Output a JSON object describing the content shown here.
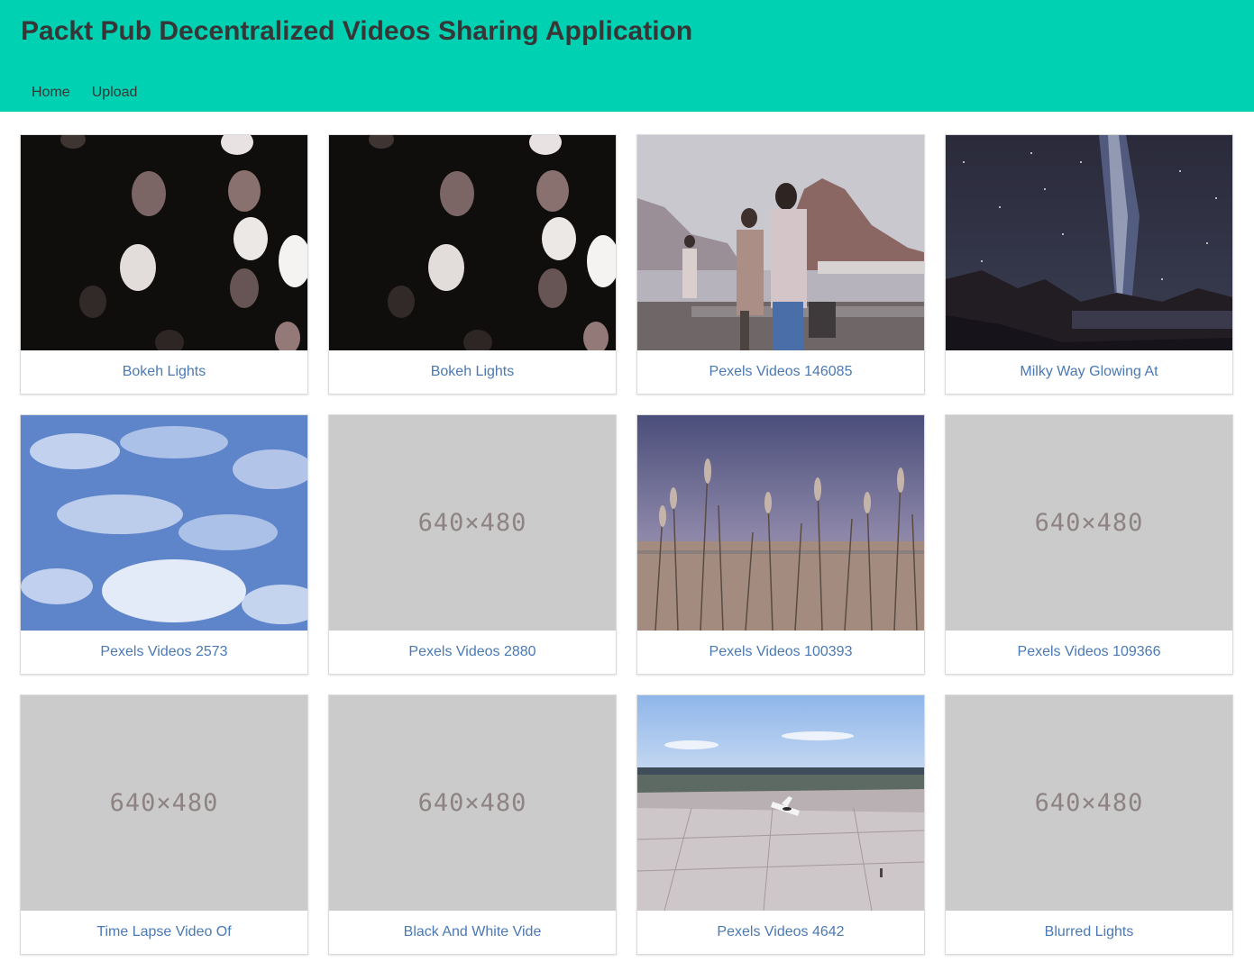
{
  "header": {
    "title": "Packt Pub Decentralized Videos Sharing Application",
    "background": "#00d1b2",
    "nav": [
      {
        "label": "Home"
      },
      {
        "label": "Upload"
      }
    ]
  },
  "videos": [
    {
      "title": "Bokeh Lights",
      "thumb": "bokeh-dark-image"
    },
    {
      "title": "Bokeh Lights",
      "thumb": "bokeh-dark-image"
    },
    {
      "title": "Pexels Videos 146085",
      "thumb": "lakeside-walk-image"
    },
    {
      "title": "Milky Way Glowing At",
      "thumb": "milky-way-image"
    },
    {
      "title": "Pexels Videos 2573",
      "thumb": "clouds-sky-image"
    },
    {
      "title": "Pexels Videos 2880",
      "thumb": "placeholder",
      "placeholder_text": "640×480"
    },
    {
      "title": "Pexels Videos 100393",
      "thumb": "reeds-field-image"
    },
    {
      "title": "Pexels Videos 109366",
      "thumb": "placeholder",
      "placeholder_text": "640×480"
    },
    {
      "title": "Time Lapse Video Of",
      "thumb": "placeholder",
      "placeholder_text": "640×480"
    },
    {
      "title": "Black And White Vide",
      "thumb": "placeholder",
      "placeholder_text": "640×480"
    },
    {
      "title": "Pexels Videos 4642",
      "thumb": "airfield-plane-image"
    },
    {
      "title": "Blurred Lights",
      "thumb": "placeholder",
      "placeholder_text": "640×480"
    }
  ]
}
